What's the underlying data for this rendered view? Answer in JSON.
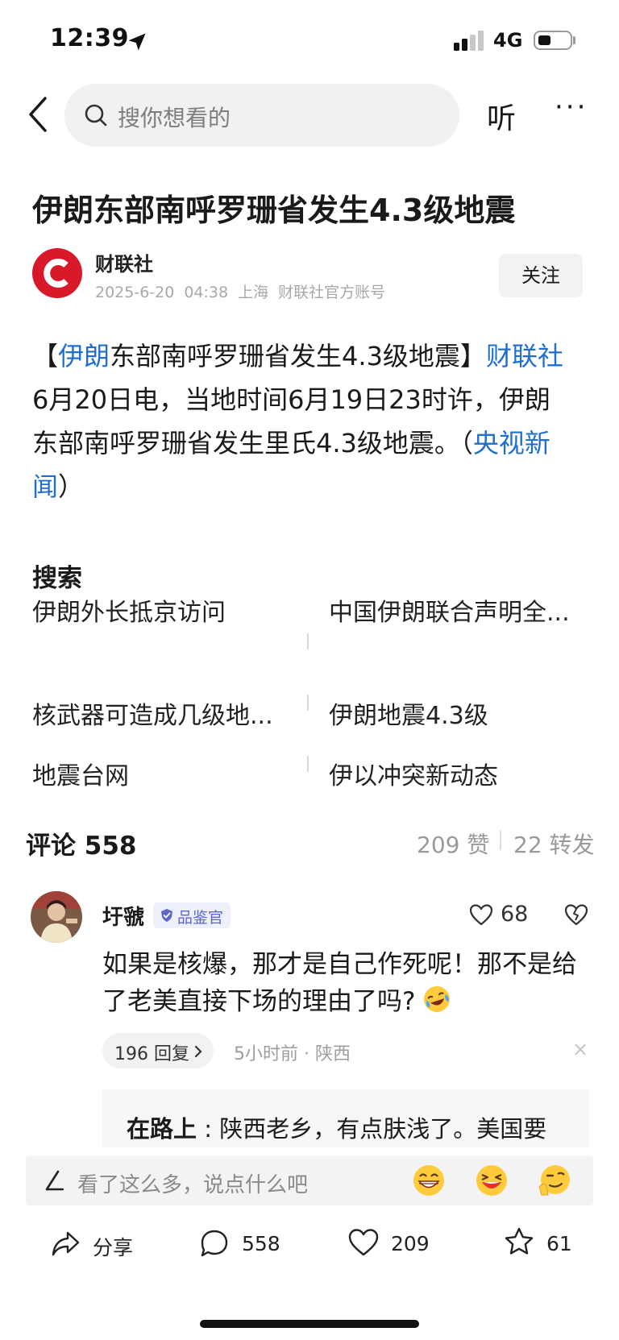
{
  "status_bar": {
    "time": "12:39",
    "network": "4G",
    "battery_fraction": 0.4
  },
  "nav": {
    "search_placeholder": "搜你想看的",
    "listen_label": "听",
    "more_label": "···"
  },
  "article": {
    "title": "伊朗东部南呼罗珊省发生4.3级地震",
    "publisher": "财联社",
    "date": "2025-6-20",
    "time": "04:38",
    "location": "上海",
    "account_type": "财联社官方账号",
    "follow_label": "关注",
    "body": {
      "bracket_open": "【",
      "link1": "伊朗",
      "part1": "东部南呼罗珊省发生4.3级地震】",
      "link2": "财联社",
      "part2": "6月20日电，当地时间6月19日23时许，伊朗东部南呼罗珊省发生里氏4.3级地震。（",
      "link3": "央视新闻",
      "part3": "）"
    }
  },
  "search_section": {
    "heading": "搜索",
    "suggestions": [
      "伊朗外长抵京访问",
      "中国伊朗联合声明全...",
      "核武器可造成几级地...",
      "伊朗地震4.3级",
      "地震台网",
      "伊以冲突新动态"
    ]
  },
  "comments": {
    "title": "评论 558",
    "likes": "209 赞",
    "reposts": "22 转发",
    "items": [
      {
        "user": "圩虢",
        "badge": "品鉴官",
        "likes": "68",
        "text": "如果是核爆，那才是自己作死呢！那不是给了老美直接下场的理由了吗?",
        "reply_label": "196 回复",
        "meta": "5小时前 · 陕西",
        "close": "×",
        "top_reply": {
          "user": "在路上",
          "separator": " : ",
          "text": "陕西老乡，有点肤浅了。美国要"
        }
      }
    ]
  },
  "comment_input": {
    "placeholder": "看了这么多，说点什么吧"
  },
  "bottom_bar": {
    "share_label": "分享",
    "comment_count": "558",
    "like_count": "209",
    "favorite_count": "61"
  },
  "colors": {
    "link": "#1f6fcf",
    "brand_red": "#d7192a",
    "badge_text": "#5b67c9"
  }
}
